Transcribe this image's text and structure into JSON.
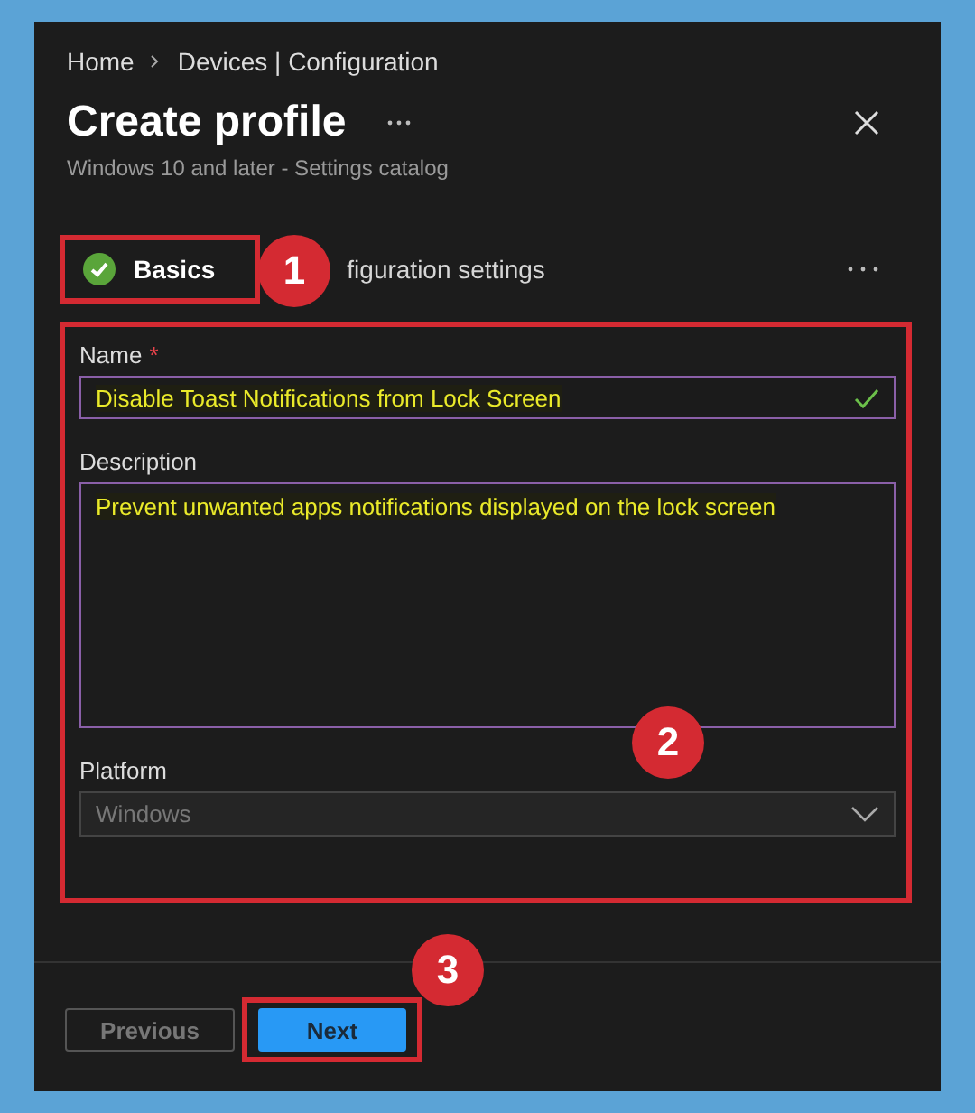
{
  "breadcrumb": [
    {
      "label": "Home"
    },
    {
      "label": "Devices | Configuration"
    }
  ],
  "title": "Create profile",
  "subtitle": "Windows 10 and later - Settings catalog",
  "steps": [
    {
      "label": "Basics",
      "complete": true,
      "selected": true
    },
    {
      "label": "figuration settings",
      "complete": false,
      "selected": false
    }
  ],
  "fields": [
    {
      "kind": "text",
      "label": "Name",
      "required_mark": "*",
      "value": "Disable Toast Notifications from Lock Screen",
      "valid": true
    },
    {
      "kind": "textarea",
      "label": "Description",
      "value": "Prevent unwanted apps notifications displayed on the lock screen"
    },
    {
      "kind": "select",
      "label": "Platform",
      "value": "Windows",
      "disabled": true
    }
  ],
  "buttons": [
    {
      "label": "Previous",
      "kind": "secondary",
      "disabled": true
    },
    {
      "label": "Next",
      "kind": "primary",
      "disabled": false
    }
  ],
  "callouts": [
    {
      "label": "1"
    },
    {
      "label": "2"
    },
    {
      "label": "3"
    }
  ]
}
